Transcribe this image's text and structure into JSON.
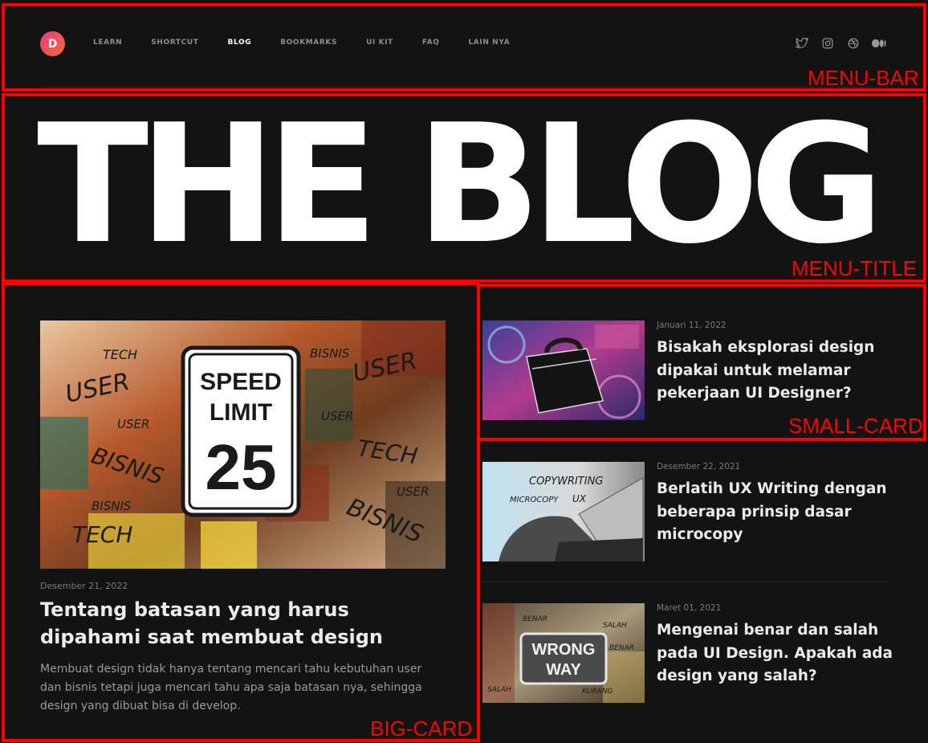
{
  "brand": {
    "initial": "D"
  },
  "nav": {
    "items": [
      {
        "label": "LEARN"
      },
      {
        "label": "SHORTCUT"
      },
      {
        "label": "BLOG",
        "active": true
      },
      {
        "label": "BOOKMARKS"
      },
      {
        "label": "UI KIT"
      },
      {
        "label": "FAQ"
      },
      {
        "label": "LAIN NYA"
      }
    ]
  },
  "socials": [
    "twitter-icon",
    "instagram-icon",
    "dribbble-icon",
    "medium-icon"
  ],
  "hero": {
    "title": "THE BLOG"
  },
  "big_card": {
    "date": "Desember 21, 2022",
    "title": "Tentang batasan yang harus dipahami saat membuat design",
    "excerpt": "Membuat design tidak hanya tentang mencari tahu kebutuhan user dan bisnis tetapi juga mencari tahu apa saja batasan nya, sehingga design yang dibuat bisa di develop.",
    "image": {
      "sign_line1": "SPEED",
      "sign_line2": "LIMIT",
      "sign_number": "25",
      "scribbles": [
        "TECH",
        "USER",
        "USER",
        "BISNIS",
        "BISNIS",
        "TECH",
        "BISNIS",
        "USER",
        "USER",
        "TECH",
        "USER",
        "BISNIS"
      ]
    }
  },
  "small_cards": [
    {
      "date": "Januari 11, 2022",
      "title": "Bisakah eksplorasi design dipakai untuk melamar pekerjaan UI Designer?"
    },
    {
      "date": "Desember 22, 2021",
      "title": "Berlatih UX Writing dengan beberapa prinsip dasar microcopy",
      "image_words": [
        "COPYWRITING",
        "MICROCOPY",
        "UX"
      ]
    },
    {
      "date": "Maret 01, 2021",
      "title": "Mengenai benar dan salah pada UI Design. Apakah ada design yang salah?",
      "image_words": [
        "WRONG",
        "WAY",
        "BENAR",
        "SALAH",
        "BENAR",
        "SALAH",
        "KURANG"
      ]
    }
  ],
  "annotations": {
    "menu_bar": "MENU-BAR",
    "menu_title": "MENU-TITLE",
    "big_card": "BIG-CARD",
    "small_card": "SMALL-CARD"
  },
  "colors": {
    "background": "#131313",
    "annotation": "#ff0000",
    "brand_from": "#f23a78",
    "brand_to": "#f06a3a"
  }
}
